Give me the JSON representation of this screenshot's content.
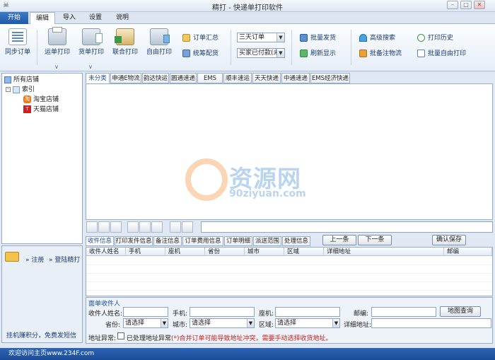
{
  "window": {
    "title": "精打 - 快递单打印软件",
    "logo_text": "☠"
  },
  "menu": [
    "开始",
    "编辑",
    "导入",
    "设置",
    "说明"
  ],
  "ribbon": {
    "sync": "同步订单",
    "waybill": "运单打印",
    "goods": "货单打印",
    "combined": "联合打印",
    "free": "自由打印",
    "summary": "订单汇总",
    "stats": "统筹配货",
    "period_value": "三天订单",
    "paystatus_value": "买家已付款(未",
    "batch_ship": "批量发货",
    "refresh": "刷新显示",
    "adv_search": "高级搜索",
    "batch_remark": "批备注物流",
    "history": "打印历史",
    "batch_free": "批量自由打印"
  },
  "tree": {
    "root": "所有店铺",
    "index": "索引",
    "shop1": "淘宝店铺",
    "shop2": "天猫店铺"
  },
  "register": {
    "login_label": "注册",
    "login2_label": "登陆精打",
    "footer": "挂机赚积分，免费发短信"
  },
  "carrier_tabs": [
    "未分类",
    "申通E物流",
    "韵达快运",
    "圆通速递",
    "EMS",
    "顺丰速运",
    "天天快递",
    "中通速递",
    "EMS经济快递"
  ],
  "info_tabs": [
    "收件信息",
    "打印发件信息",
    "备注信息",
    "订单费用信息",
    "订单明细",
    "派送范围",
    "处理信息"
  ],
  "buttons": {
    "prev": "上一条",
    "next": "下一条",
    "confirm": "确认保存",
    "map": "地图查询"
  },
  "grid_headers": [
    "收件人姓名",
    "手机",
    "座机",
    "省份",
    "城市",
    "区域",
    "详细地址",
    "邮编"
  ],
  "form": {
    "group": "面单收件人",
    "name": "收件人姓名:",
    "mobile": "手机:",
    "phone": "座机:",
    "zip": "邮编:",
    "province": "省份:",
    "city": "城市:",
    "area": "区域:",
    "address": "详细地址:",
    "select": "请选择",
    "abnormal": "地址异常:",
    "processed": "已处理地址异常",
    "warn": "(*)合并订单可能导致地址冲突，需要手动选择收货地址。"
  },
  "watermark": {
    "text": "资源网",
    "sub": "90ziyuan.com"
  },
  "status": "欢迎访问主页www.234F.com"
}
